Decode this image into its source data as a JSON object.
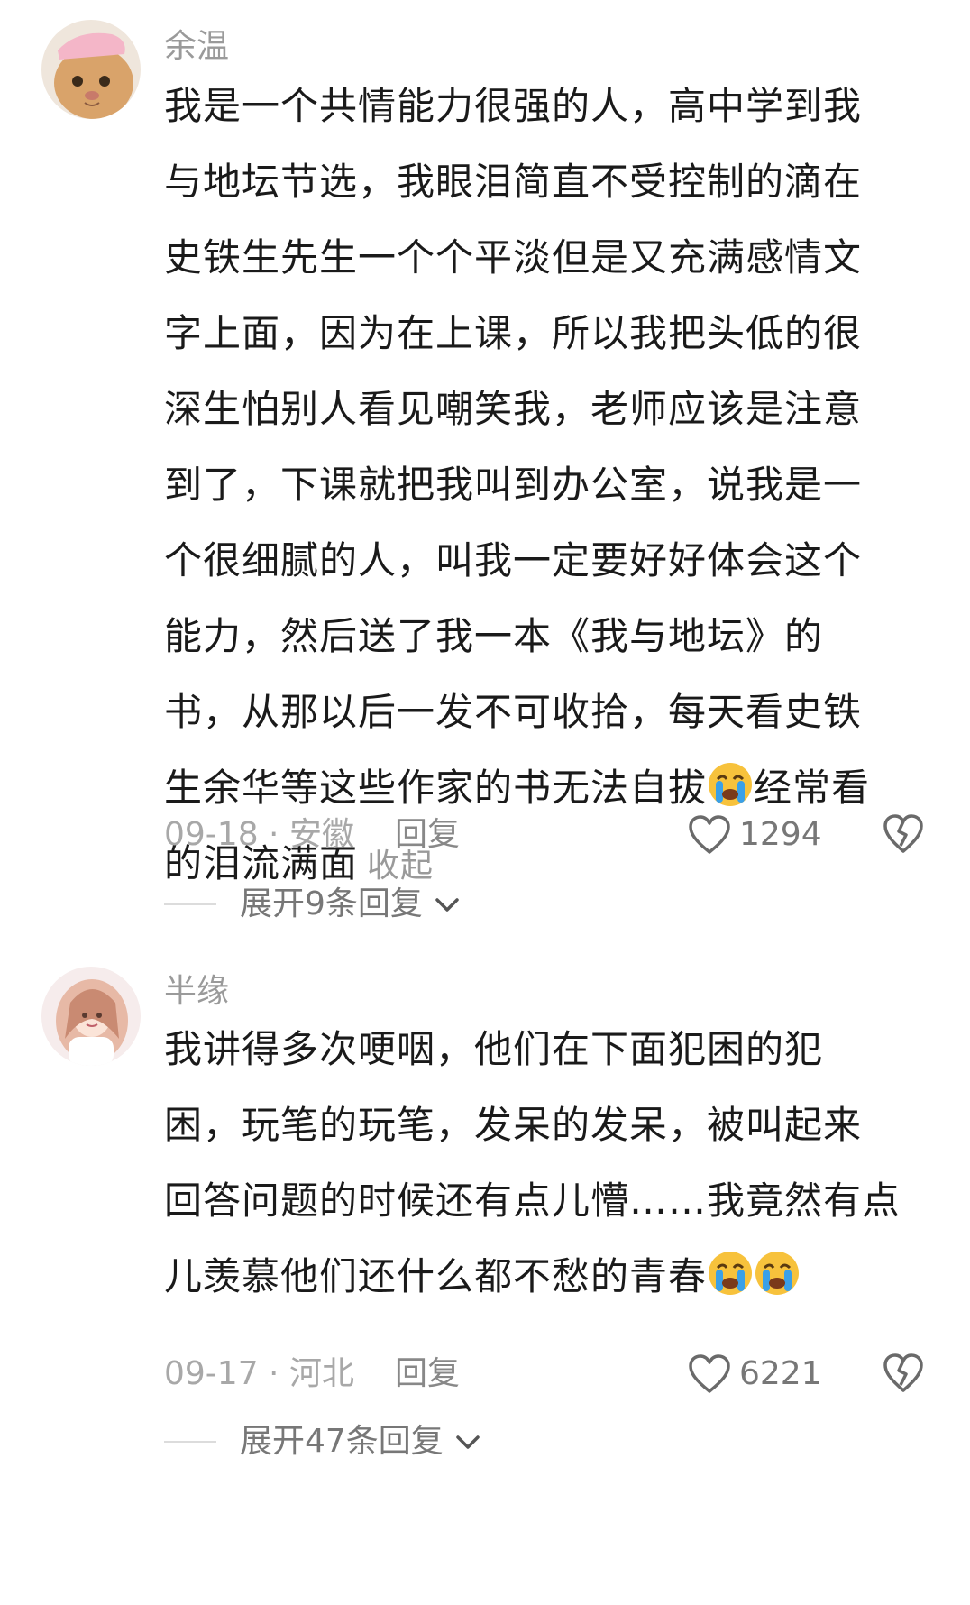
{
  "comments": [
    {
      "username": "余温",
      "lines": [
        "我是一个共情能力很强的人，高中学到我",
        "与地坛节选，我眼泪简直不受控制的滴在",
        "史铁生先生一个个平淡但是又充满感情文",
        "字上面，因为在上课，所以我把头低的很",
        "深生怕别人看见嘲笑我，老师应该是注意",
        "到了，下课就把我叫到办公室，说我是一",
        "个很细腻的人，叫我一定要好好体会这个",
        "能力，然后送了我一本《我与地坛》的",
        "书，从那以后一发不可收拾，每天看史铁",
        "生余华等这些作家的书无法自拔",
        "经常看",
        "的泪流满面"
      ],
      "collapse_label": "收起",
      "date_location": "09-18 · 安徽",
      "reply_label": "回复",
      "likes": "1294",
      "expand_label": "展开9条回复"
    },
    {
      "username": "半缘",
      "lines": [
        "我讲得多次哽咽，他们在下面犯困的犯",
        "困，玩笔的玩笔，发呆的发呆，被叫起来",
        "回答问题的时候还有点儿懵……我竟然有点",
        "儿羡慕他们还什么都不愁的青春"
      ],
      "date_location": "09-17 · 河北",
      "reply_label": "回复",
      "likes": "6221",
      "expand_label": "展开47条回复"
    }
  ],
  "colors": {
    "text": "#1a1a1a",
    "muted": "#9a9a9a",
    "emoji_face": "#f7c23c",
    "emoji_tear": "#3aa0e8"
  },
  "icons": [
    "heart-icon",
    "dislike-icon",
    "chevron-down-icon",
    "crying-emoji-icon"
  ]
}
